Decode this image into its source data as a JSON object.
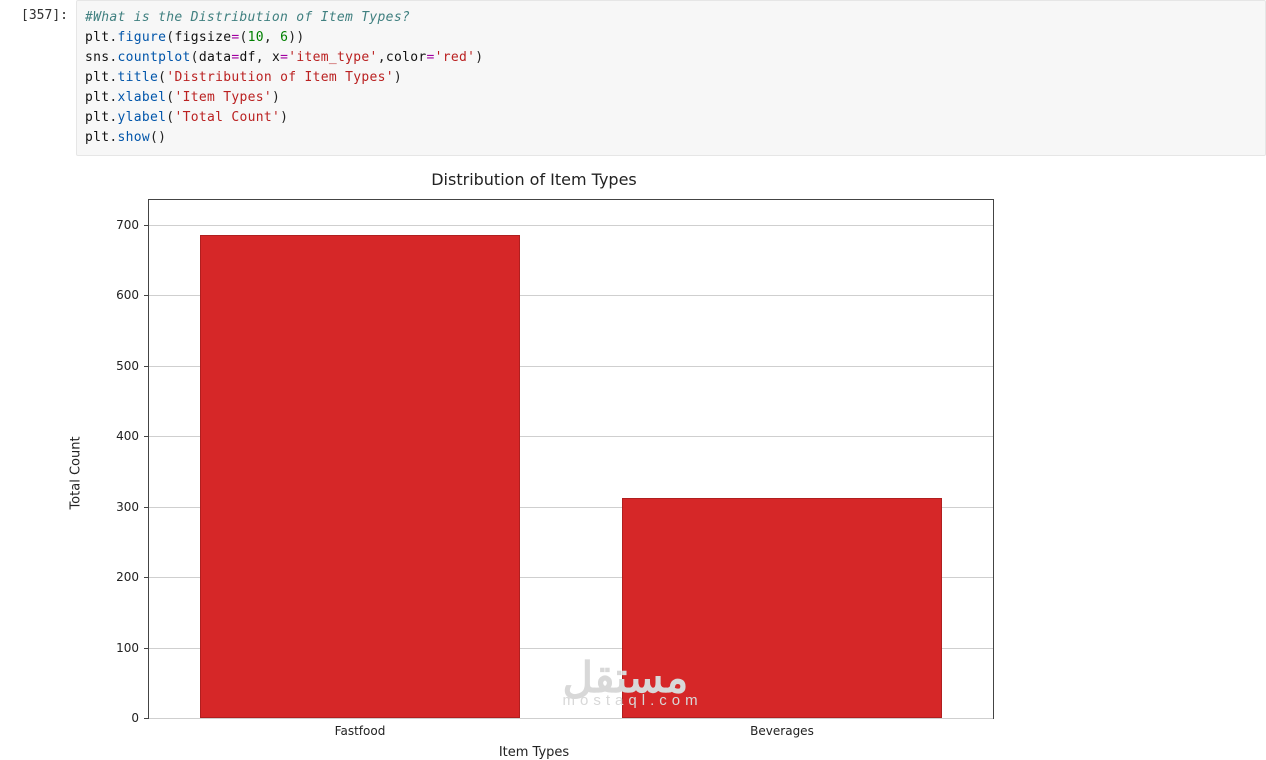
{
  "cell": {
    "prompt": "[357]:",
    "code": {
      "l1_comment": "#What is the Distribution of Item Types?",
      "l2": {
        "obj": "plt",
        "fn": "figure",
        "kw": "figsize",
        "eq": "=",
        "p1": "(",
        "n1": "10",
        "comma": ", ",
        "n2": "6",
        "p2": ")"
      },
      "l3": {
        "obj": "sns",
        "fn": "countplot",
        "kw1": "data",
        "v1": "df",
        "kw2": "x",
        "s2": "'item_type'",
        "kw3": "color",
        "s3": "'red'",
        "eq": "="
      },
      "l4": {
        "obj": "plt",
        "fn": "title",
        "s": "'Distribution of Item Types'"
      },
      "l5": {
        "obj": "plt",
        "fn": "xlabel",
        "s": "'Item Types'"
      },
      "l6": {
        "obj": "plt",
        "fn": "ylabel",
        "s": "'Total Count'"
      },
      "l7": {
        "obj": "plt",
        "fn": "show"
      }
    }
  },
  "chart_data": {
    "type": "bar",
    "title": "Distribution of Item Types",
    "xlabel": "Item Types",
    "ylabel": "Total Count",
    "categories": [
      "Fastfood",
      "Beverages"
    ],
    "values": [
      685,
      312
    ],
    "ylim": [
      0,
      735
    ],
    "yticks": [
      0,
      100,
      200,
      300,
      400,
      500,
      600,
      700
    ],
    "bar_color": "#d62728"
  },
  "watermark": {
    "big": "مستقل",
    "small": "mostaql.com"
  }
}
